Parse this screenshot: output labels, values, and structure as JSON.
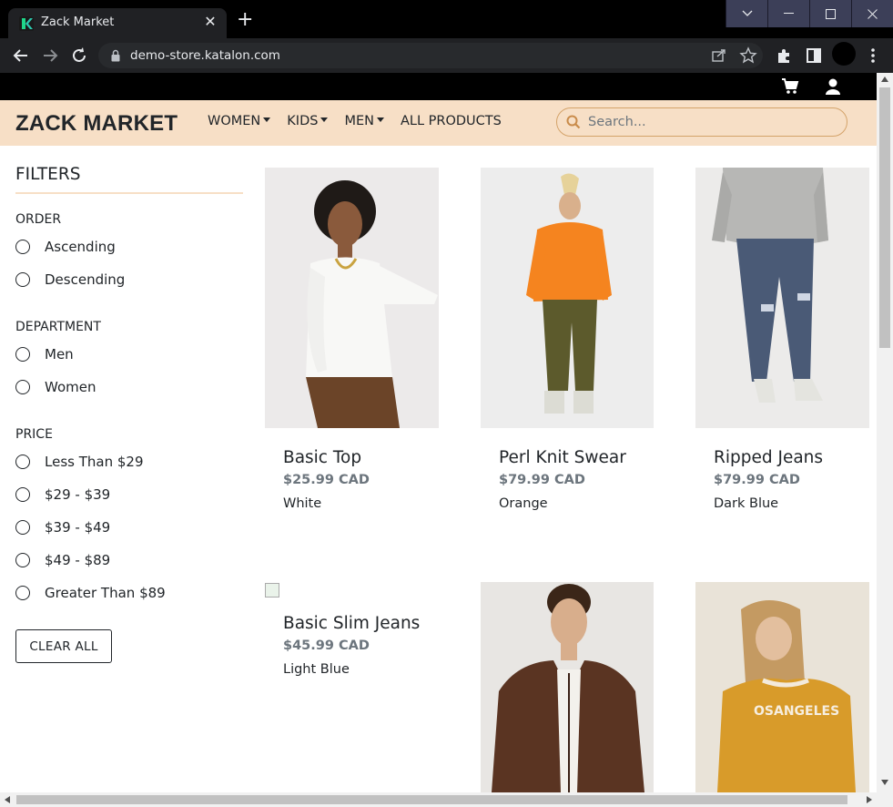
{
  "browser": {
    "tab_title": "Zack Market",
    "url": "demo-store.katalon.com",
    "new_tab": "+",
    "close": "✕"
  },
  "site": {
    "brand": "ZACK MARKET",
    "nav": [
      {
        "label": "WOMEN",
        "dropdown": true
      },
      {
        "label": "KIDS",
        "dropdown": true
      },
      {
        "label": "MEN",
        "dropdown": true
      },
      {
        "label": "ALL PRODUCTS",
        "dropdown": false
      }
    ],
    "search_placeholder": "Search...",
    "accent_color": "#f7dfc6"
  },
  "filters": {
    "title": "FILTERS",
    "order": {
      "title": "ORDER",
      "options": [
        "Ascending",
        "Descending"
      ]
    },
    "department": {
      "title": "DEPARTMENT",
      "options": [
        "Men",
        "Women"
      ]
    },
    "price": {
      "title": "PRICE",
      "options": [
        "Less Than $29",
        "$29 - $39",
        "$39 - $49",
        "$49 - $89",
        "Greater Than $89"
      ]
    },
    "clear_label": "CLEAR ALL"
  },
  "products": [
    {
      "name": "Basic Top",
      "price": "$25.99 CAD",
      "color": "White"
    },
    {
      "name": "Perl Knit Swear",
      "price": "$79.99 CAD",
      "color": "Orange"
    },
    {
      "name": "Ripped Jeans",
      "price": "$79.99 CAD",
      "color": "Dark Blue"
    },
    {
      "name": "Basic Slim Jeans",
      "price": "$45.99 CAD",
      "color": "Light Blue"
    },
    {
      "name": "",
      "price": "",
      "color": ""
    },
    {
      "name": "",
      "price": "",
      "color": ""
    }
  ]
}
